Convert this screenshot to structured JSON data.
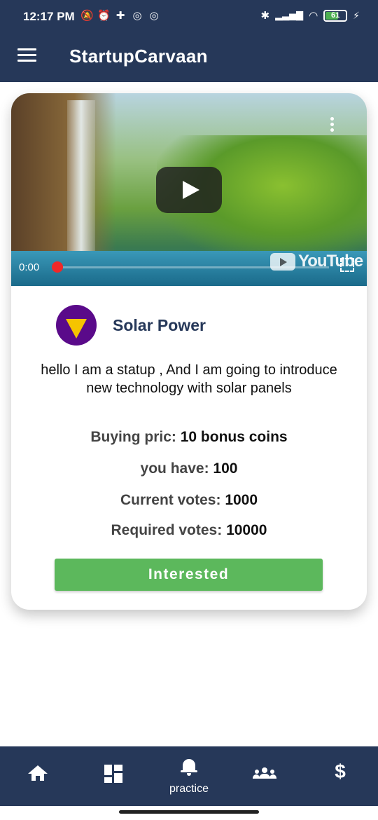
{
  "status_bar": {
    "time": "12:17 PM",
    "battery": "61",
    "icons": [
      "mute-icon",
      "alarm-icon",
      "vpn-icon",
      "sync-icon",
      "sync-icon",
      "bluetooth-icon",
      "signal-icon",
      "wifi-icon",
      "battery-icon",
      "charging-icon"
    ]
  },
  "app_bar": {
    "title": "StartupCarvaan"
  },
  "card": {
    "video": {
      "time": "0:00",
      "logo_text": "YouTube",
      "progress": 0
    },
    "startup_name": "Solar Power",
    "description": "hello I am a statup , And I am going to introduce new technology with solar panels",
    "buying_label": "Buying pric:",
    "buying_value": "10 bonus coins",
    "have_label": "you have:",
    "have_value": "100",
    "current_label": "Current votes:",
    "current_value": "1000",
    "required_label": "Required votes:",
    "required_value": "10000",
    "button_label": "Interested"
  },
  "bottom_nav": {
    "items": [
      {
        "icon": "home-icon",
        "label": ""
      },
      {
        "icon": "dashboard-icon",
        "label": ""
      },
      {
        "icon": "bell-icon",
        "label": "practice"
      },
      {
        "icon": "group-icon",
        "label": ""
      },
      {
        "icon": "dollar-icon",
        "label": ""
      }
    ]
  },
  "colors": {
    "primary": "#263859",
    "button": "#5cb85c",
    "avatar_bg": "#5a0a8a",
    "avatar_fg": "#f5c400",
    "progress_dot": "#f02828"
  }
}
